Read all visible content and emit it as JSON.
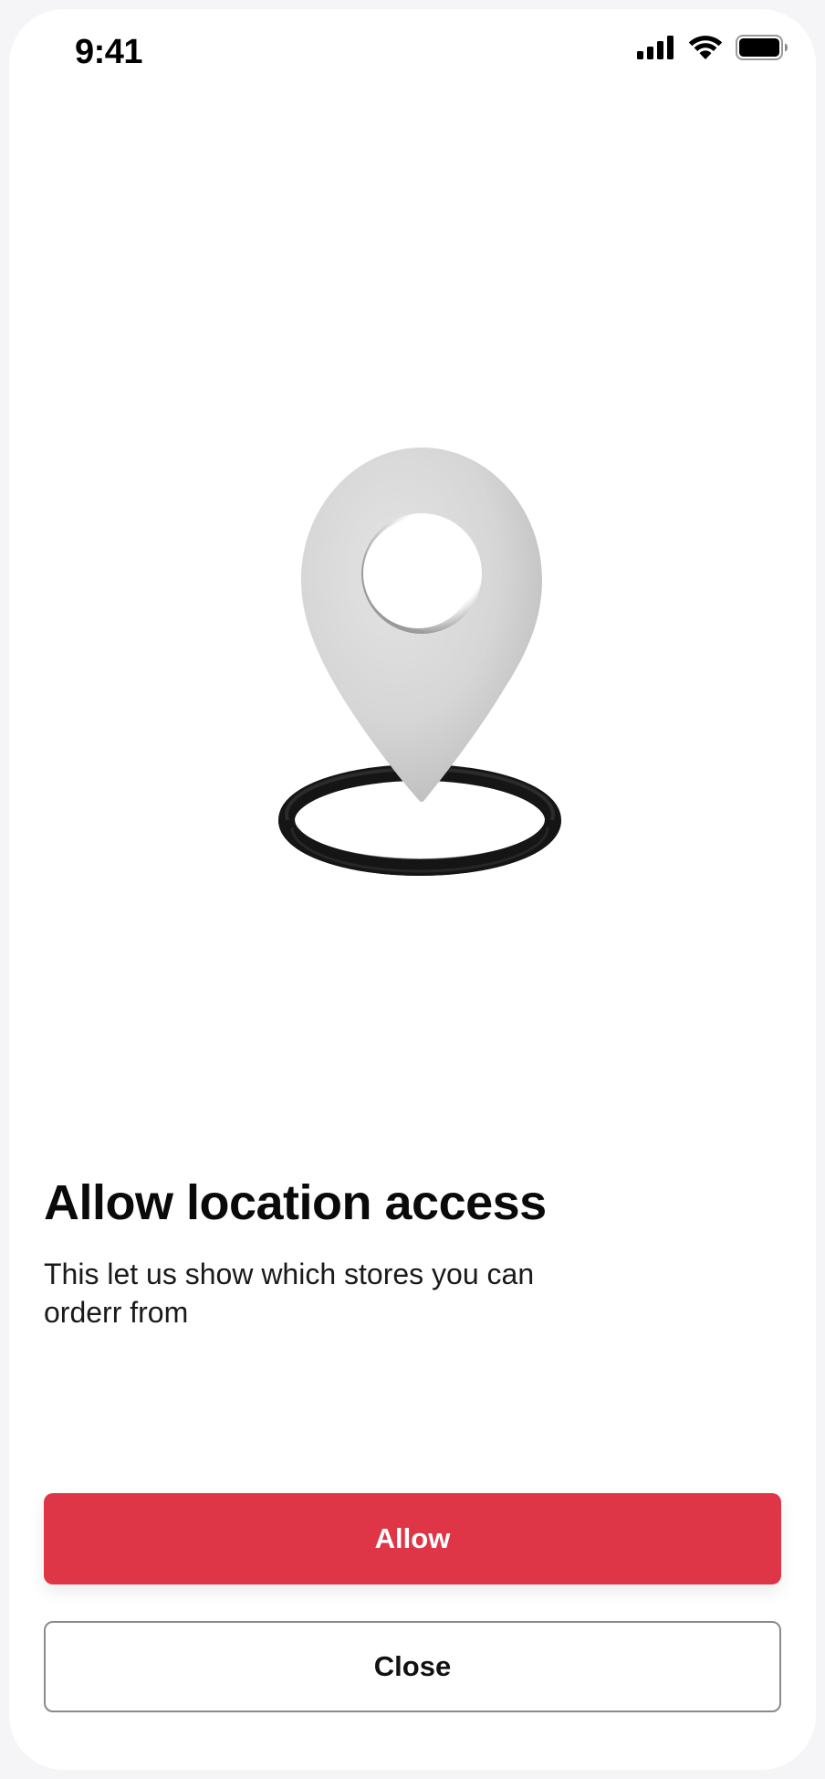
{
  "status_bar": {
    "time": "9:41"
  },
  "icons": {
    "signal": "cellular-signal-icon",
    "wifi": "wifi-icon",
    "battery": "battery-icon",
    "illustration": "location-pin-illustration"
  },
  "content": {
    "title": "Allow location access",
    "subtitle": "This let us show which stores you can orderr from"
  },
  "buttons": {
    "allow_label": "Allow",
    "close_label": "Close"
  },
  "colors": {
    "primary": "#de3646",
    "text": "#0a0a0a",
    "background": "#ffffff"
  }
}
